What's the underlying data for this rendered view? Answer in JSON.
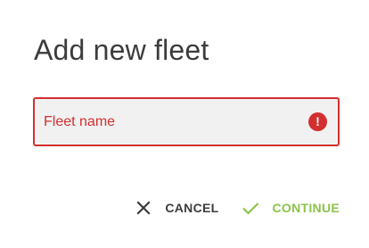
{
  "dialog": {
    "title": "Add new fleet",
    "field": {
      "placeholder": "Fleet name",
      "value": "",
      "error_icon": "alert-circle-icon",
      "error_color": "#d32f2f"
    },
    "actions": {
      "cancel_label": "CANCEL",
      "cancel_icon": "close-icon",
      "continue_label": "CONTINUE",
      "continue_icon": "check-icon",
      "continue_color": "#8bc34a"
    }
  }
}
